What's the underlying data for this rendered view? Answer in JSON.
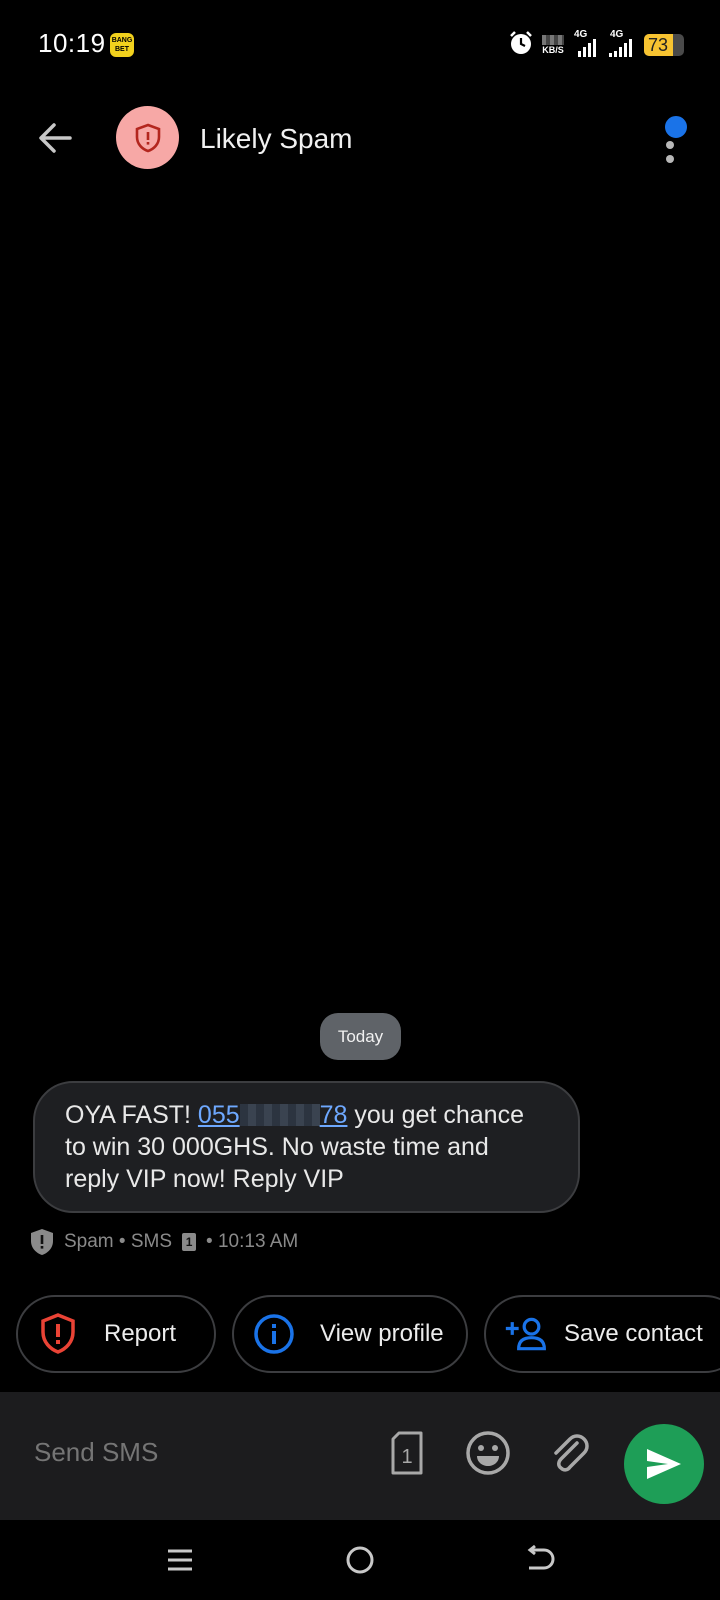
{
  "status_bar": {
    "time": "10:19",
    "app_badge": "BANG BET",
    "net_unit": "KB/S",
    "sim1_label": "4G",
    "sim2_label": "4G",
    "battery": "73"
  },
  "header": {
    "title": "Likely Spam"
  },
  "thread": {
    "date_label": "Today",
    "message": {
      "prefix": "OYA FAST! ",
      "phone_start": "055",
      "phone_end": "78",
      "suffix": " you get chance to win 30 000GHS. No waste time and reply VIP now! Reply VIP"
    },
    "meta": {
      "type": "Spam • SMS",
      "sim": "1",
      "time": "• 10:13 AM"
    }
  },
  "actions": {
    "report": "Report",
    "view_profile": "View profile",
    "save_contact": "Save contact"
  },
  "composer": {
    "placeholder": "Send SMS",
    "sim": "1"
  },
  "colors": {
    "background": "#000000",
    "spam_avatar": "#f7a8a6",
    "spam_red": "#ea4335",
    "link_blue": "#6ea8fe",
    "action_blue": "#1a73e8",
    "send_green": "#1e9e57"
  }
}
